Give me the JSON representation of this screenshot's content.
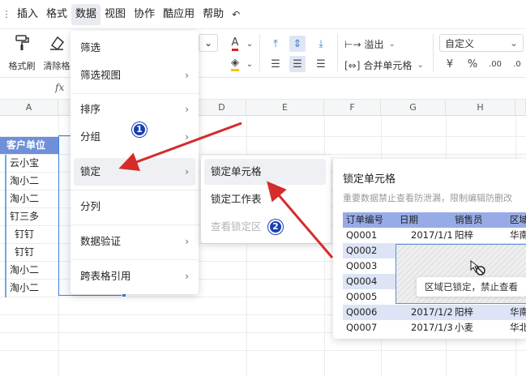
{
  "menubar": {
    "items": [
      "插入",
      "格式",
      "数据",
      "视图",
      "协作",
      "酷应用",
      "帮助"
    ],
    "active_index": 2
  },
  "toolbar": {
    "format_painter": "格式刷",
    "clear_format": "清除格",
    "wrap": "溢出",
    "merge": "合并单元格",
    "number_format": "自定义",
    "currency": "¥",
    "percent": "%"
  },
  "formulabar": {
    "fx": "fx"
  },
  "grid": {
    "columns": [
      "A",
      "D",
      "E",
      "F",
      "G",
      "H"
    ],
    "header_cell": "客户单位",
    "a_values": [
      "云小宝",
      "淘小二",
      "淘小二",
      "钉三多",
      "钉钉",
      "钉钉",
      "淘小二",
      "淘小二"
    ]
  },
  "menu": {
    "items": [
      {
        "label": "筛选",
        "submenu": false
      },
      {
        "label": "筛选视图",
        "submenu": true
      },
      {
        "label": "排序",
        "submenu": true
      },
      {
        "label": "分组",
        "submenu": true
      },
      {
        "label": "锁定",
        "submenu": true,
        "highlighted": true
      },
      {
        "label": "分列",
        "submenu": false
      },
      {
        "label": "数据验证",
        "submenu": true
      },
      {
        "label": "跨表格引用",
        "submenu": true
      }
    ]
  },
  "submenu": {
    "items": [
      {
        "label": "锁定单元格",
        "highlighted": true,
        "disabled": false
      },
      {
        "label": "锁定工作表",
        "highlighted": false,
        "disabled": false
      },
      {
        "label": "查看锁定区",
        "highlighted": false,
        "disabled": true
      }
    ]
  },
  "preview": {
    "title": "锁定单元格",
    "description": "重要数据禁止查看防泄漏，限制编辑防删改",
    "headers": [
      "订单编号",
      "日期",
      "销售员",
      "区域"
    ],
    "rows": [
      [
        "Q0001",
        "2017/1/1",
        "阳梓",
        "华南"
      ],
      [
        "Q0002",
        "",
        "",
        ""
      ],
      [
        "Q0003",
        "",
        "",
        ""
      ],
      [
        "Q0004",
        "",
        "",
        ""
      ],
      [
        "Q0005",
        "",
        "",
        ""
      ],
      [
        "Q0006",
        "2017/1/2",
        "阳梓",
        "华南"
      ],
      [
        "Q0007",
        "2017/1/3",
        "小麦",
        "华北"
      ]
    ],
    "lock_message": "区域已锁定，禁止查看"
  },
  "badges": [
    "1",
    "2"
  ],
  "colors": {
    "accent": "#3c7fe0",
    "header_fill": "#6f8fd9",
    "preview_header": "#97abe6",
    "preview_alt": "#dde4f6",
    "arrow": "#d62b2b",
    "badge": "#1a3fae"
  }
}
